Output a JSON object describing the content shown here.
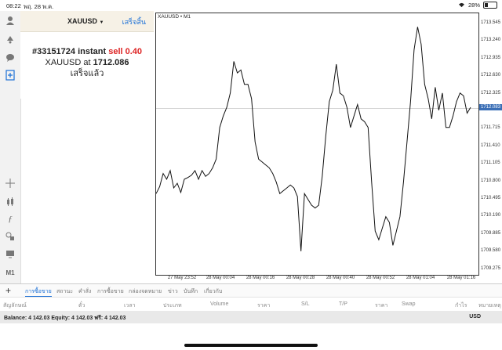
{
  "status": {
    "time": "08:22",
    "date": "พฤ. 28 พ.ค.",
    "battery": "28%"
  },
  "order_panel": {
    "symbol": "XAUUSD",
    "done_button": "เสร็จสิ้น",
    "ticket": "#33151724 instant",
    "action": "sell 0.40",
    "price_prefix": "XAUUSD at",
    "price": "1712.086",
    "status": "เสร็จแล้ว"
  },
  "chart": {
    "title": "XAUUSD • M1",
    "current_price_label": "1712.083",
    "colors": {
      "line": "#111111",
      "price_badge": "#3b6fb6"
    }
  },
  "chart_data": {
    "type": "line",
    "ylim": [
      1709.27,
      1713.545
    ],
    "y_ticks": [
      "1713.545",
      "1713.240",
      "1712.935",
      "1712.630",
      "1712.325",
      "1712.083",
      "1711.715",
      "1711.410",
      "1711.105",
      "1710.800",
      "1710.495",
      "1710.190",
      "1709.885",
      "1709.580",
      "1709.275"
    ],
    "x_ticks": [
      "27 May 23:52",
      "28 May 00:04",
      "28 May 00:16",
      "28 May 00:28",
      "28 May 00:40",
      "28 May 00:52",
      "28 May 01:04",
      "28 May 01:16"
    ],
    "series": [
      {
        "values": [
          1710.6,
          1710.72,
          1710.95,
          1710.85,
          1711.0,
          1710.7,
          1710.78,
          1710.62,
          1710.85,
          1710.88,
          1710.92,
          1711.0,
          1710.85,
          1711.0,
          1710.9,
          1710.95,
          1711.05,
          1711.2,
          1711.75,
          1711.95,
          1712.1,
          1712.35,
          1712.9,
          1712.7,
          1712.75,
          1712.5,
          1712.5,
          1712.25,
          1711.5,
          1711.2,
          1711.15,
          1711.1,
          1711.05,
          1710.95,
          1710.8,
          1710.6,
          1710.65,
          1710.7,
          1710.75,
          1710.7,
          1710.55,
          1709.6,
          1710.6,
          1710.5,
          1710.4,
          1710.35,
          1710.4,
          1710.9,
          1711.6,
          1712.2,
          1712.4,
          1712.85,
          1712.35,
          1712.3,
          1712.1,
          1711.75,
          1711.95,
          1712.15,
          1711.9,
          1711.85,
          1711.75,
          1710.8,
          1709.95,
          1709.8,
          1710.0,
          1710.2,
          1710.1,
          1709.7,
          1709.95,
          1710.2,
          1710.8,
          1711.5,
          1712.2,
          1713.1,
          1713.5,
          1713.2,
          1712.5,
          1712.25,
          1711.9,
          1712.45,
          1712.05,
          1712.35,
          1711.75,
          1711.75,
          1711.95,
          1712.2,
          1712.35,
          1712.3,
          1712.0,
          1712.1
        ]
      }
    ]
  },
  "tabs": {
    "items": [
      "การซื้อขาย",
      "สถานะ",
      "คำสั่ง",
      "การซื้อขาย",
      "กล่องจดหมาย",
      "ข่าว",
      "บันทึก",
      "เกี่ยวกับ"
    ]
  },
  "columns": {
    "items": [
      "สัญลักษณ์",
      "ตั๋ว",
      "เวลา",
      "ประเภท",
      "Volume",
      "ราคา",
      "S/L",
      "T/P",
      "ราคา",
      "Swap",
      "กำไร",
      "หมายเหตุ"
    ]
  },
  "account": {
    "balance_text": "Balance: 4 142.03  Equity: 4 142.03  ฟรี: 4 142.03",
    "currency": "USD"
  }
}
